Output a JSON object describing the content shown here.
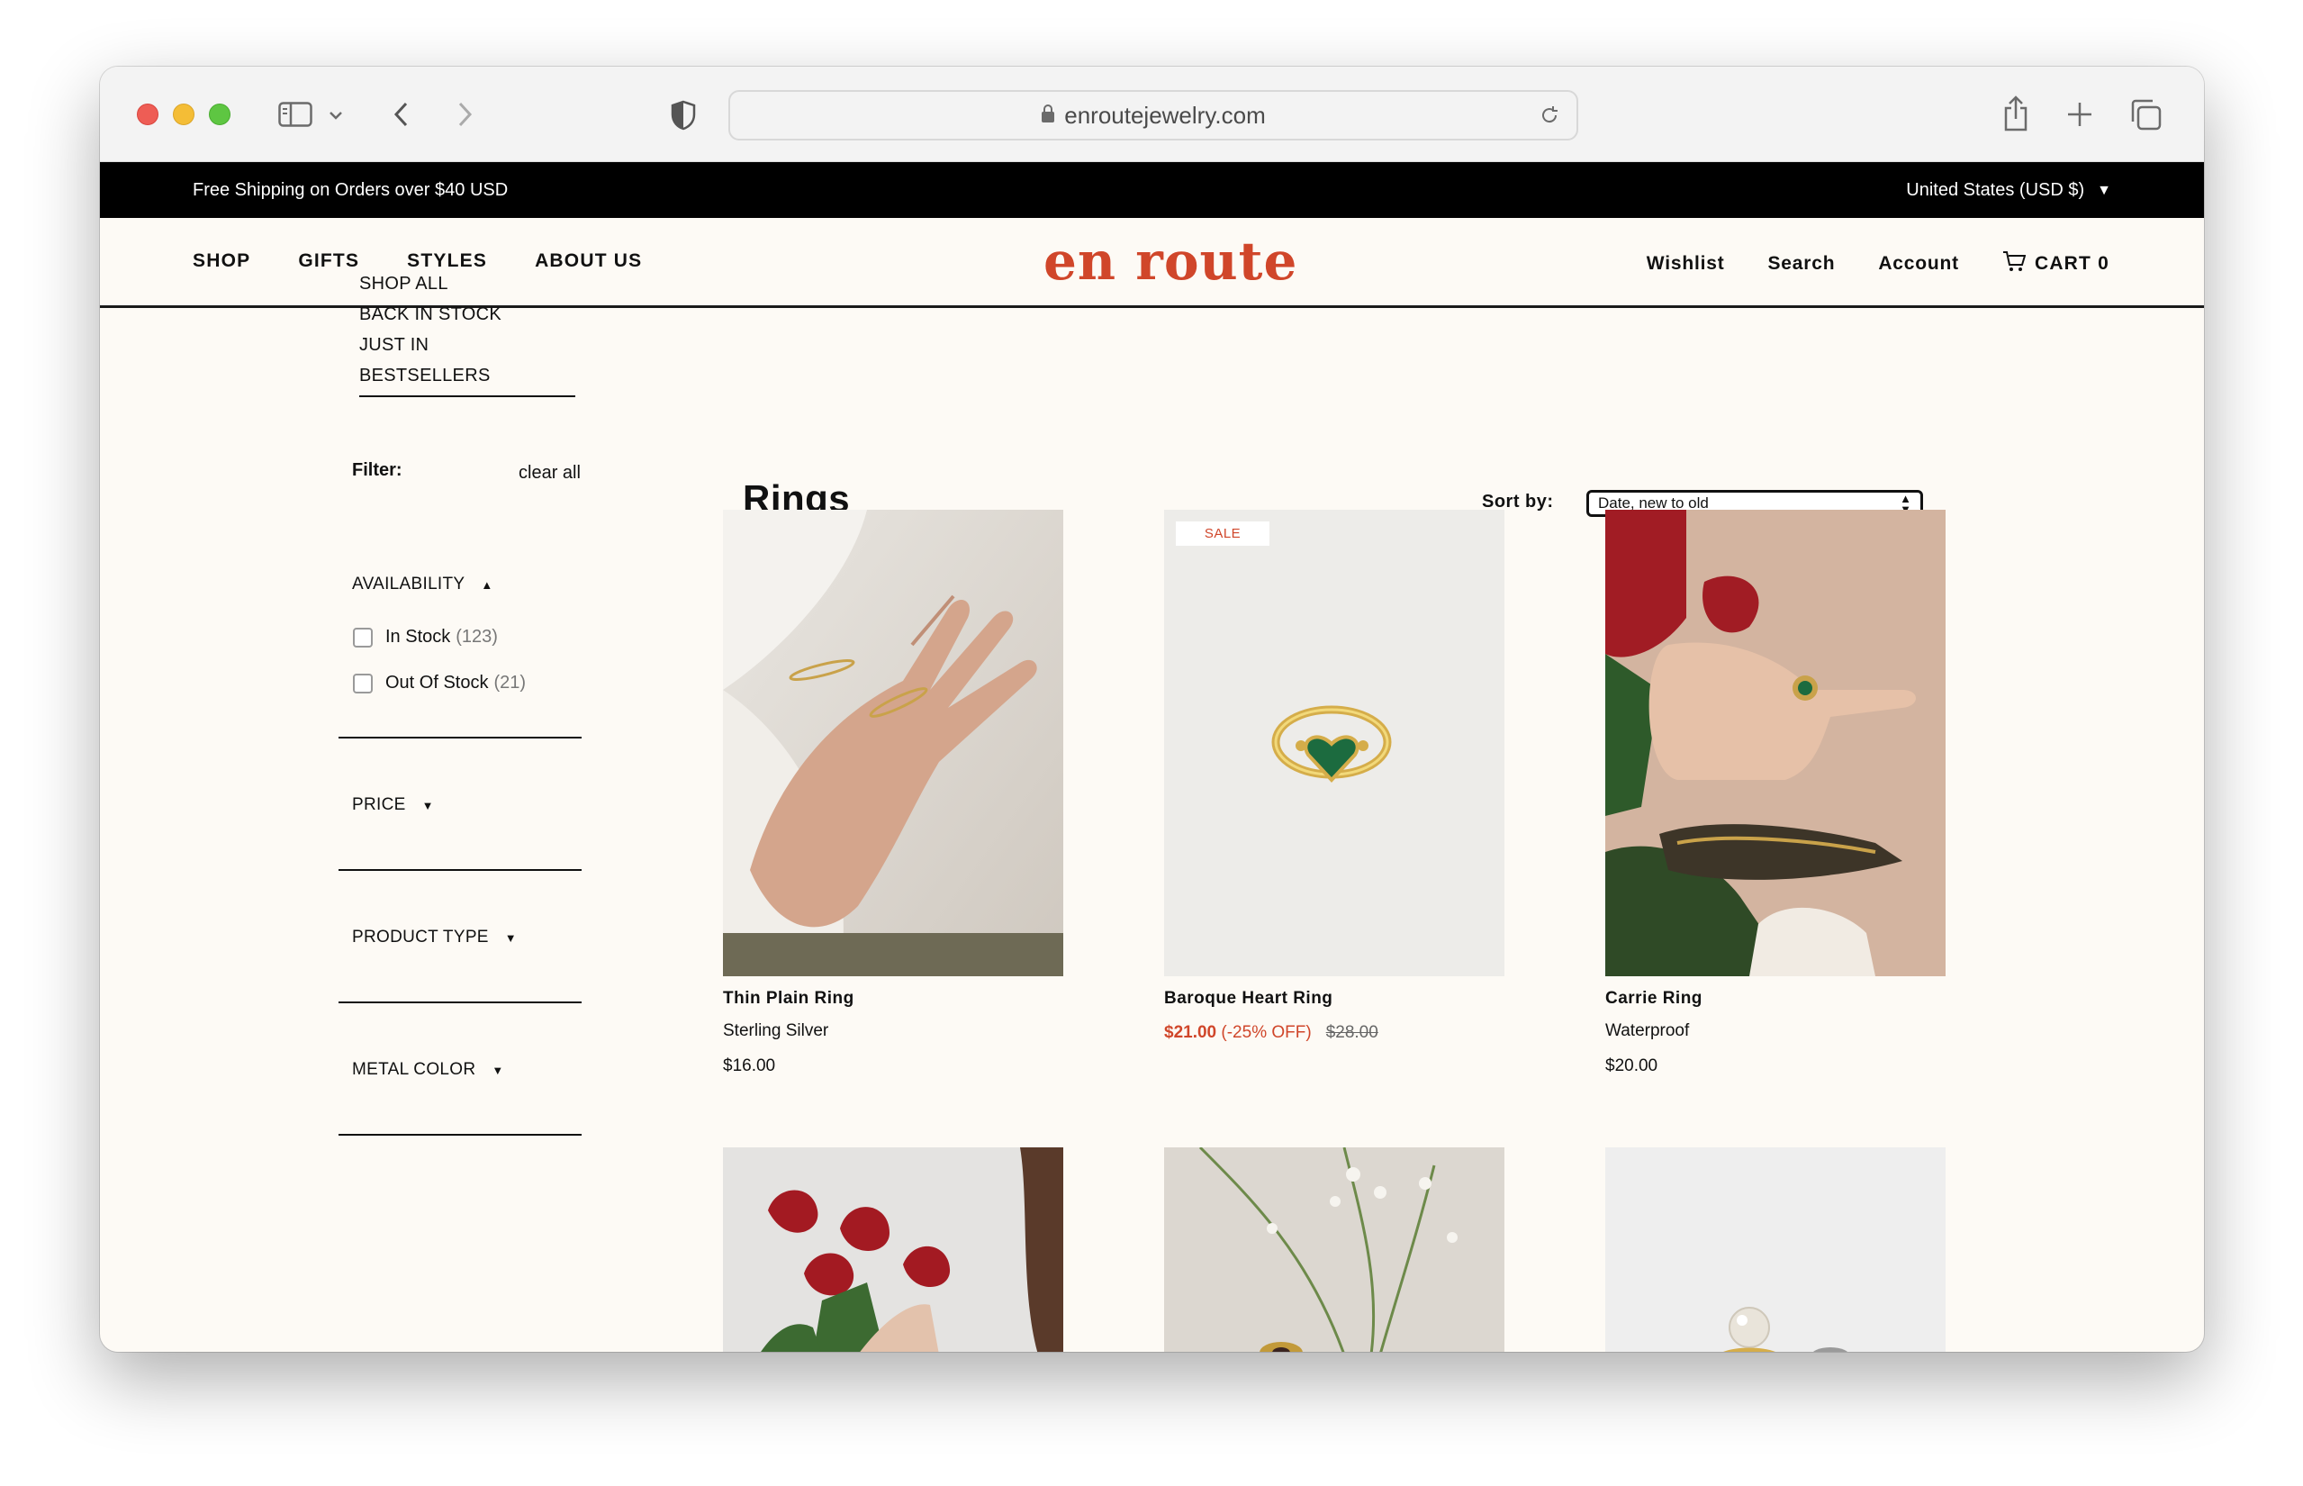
{
  "browser": {
    "url": "enroutejewelry.com",
    "icons": [
      "sidebar-icon",
      "chevron-down-icon",
      "back-icon",
      "forward-icon",
      "shield-icon",
      "lock-icon",
      "reload-icon",
      "share-icon",
      "new-tab-icon",
      "tabs-icon"
    ]
  },
  "announcement": {
    "left_text": "Free Shipping on Orders over $40 USD",
    "currency": "United States (USD $)"
  },
  "header": {
    "nav_left": [
      "SHOP",
      "GIFTS",
      "STYLES",
      "ABOUT US"
    ],
    "logo": "en route",
    "nav_right": [
      "Wishlist",
      "Search",
      "Account"
    ],
    "cart_label": "CART 0",
    "brand_color": "#d0462a"
  },
  "sidebar": {
    "categories": [
      "SHOP ALL",
      "BACK IN STOCK",
      "JUST IN",
      "BESTSELLERS"
    ],
    "filter_label": "Filter:",
    "clear_all": "clear all",
    "availability": {
      "title": "AVAILABILITY",
      "options": [
        {
          "label": "In Stock",
          "count": "(123)"
        },
        {
          "label": "Out Of Stock",
          "count": "(21)"
        }
      ]
    },
    "price": "PRICE",
    "product_type": "PRODUCT TYPE",
    "metal_color": "METAL COLOR"
  },
  "main": {
    "title": "Rings",
    "sort_label": "Sort by:",
    "sort_value": "Date, new to old",
    "products": [
      {
        "name": "Thin Plain Ring",
        "subtitle": "Sterling Silver",
        "price": "$16.00"
      },
      {
        "name": "Baroque Heart Ring",
        "badge": "SALE",
        "sale_price": "$21.00",
        "discount": "(-25% OFF)",
        "compare_price": "$28.00"
      },
      {
        "name": "Carrie Ring",
        "subtitle": "Waterproof",
        "price": "$20.00"
      }
    ]
  }
}
